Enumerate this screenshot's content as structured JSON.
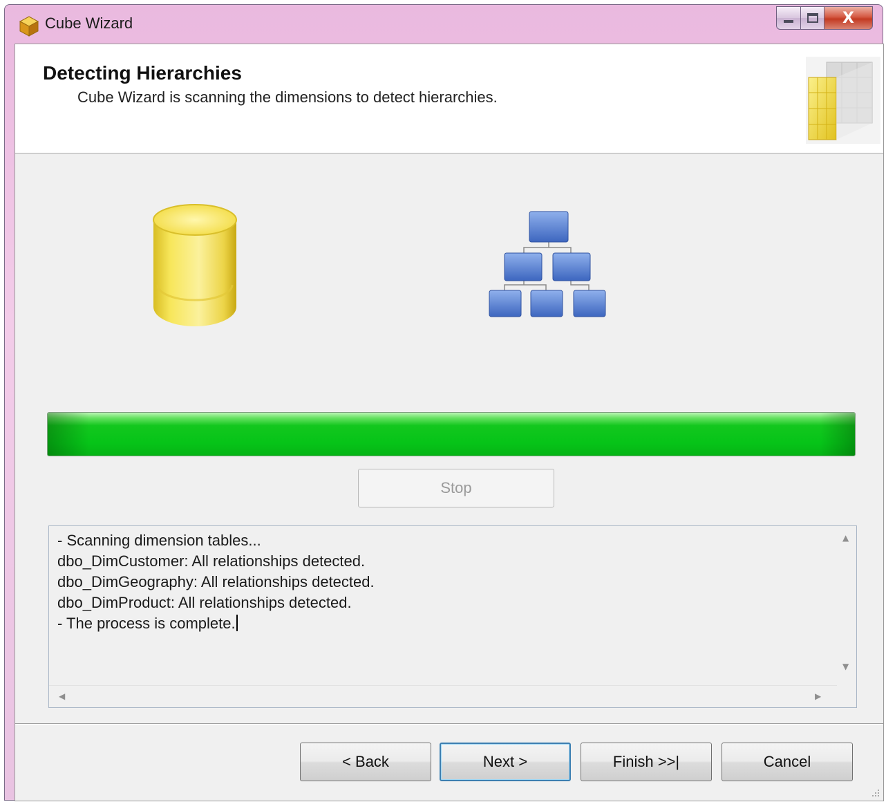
{
  "window": {
    "title": "Cube Wizard",
    "controls": {
      "close_symbol": "X"
    }
  },
  "header": {
    "title": "Detecting Hierarchies",
    "subtitle": "Cube Wizard is scanning the dimensions to detect hierarchies."
  },
  "icons": {
    "app": "cube-icon",
    "header": "cube-grid-icon",
    "source": "database-cylinder-icon",
    "target": "hierarchy-icon"
  },
  "progress": {
    "fraction": 1.0,
    "color": "#06c418"
  },
  "stop_button": {
    "label": "Stop",
    "enabled": false
  },
  "log": {
    "lines": [
      "- Scanning dimension tables...",
      "dbo_DimCustomer: All relationships detected.",
      "dbo_DimGeography: All relationships detected.",
      "dbo_DimProduct: All relationships detected.",
      "- The process is complete."
    ]
  },
  "buttons": {
    "back": "< Back",
    "next": "Next >",
    "finish": "Finish >>|",
    "cancel": "Cancel"
  },
  "colors": {
    "accent": "#3c7fb1",
    "title_bar": "#eab9df",
    "cylinder": "#f2dd4a",
    "hierarchy": "#4f79c9"
  }
}
